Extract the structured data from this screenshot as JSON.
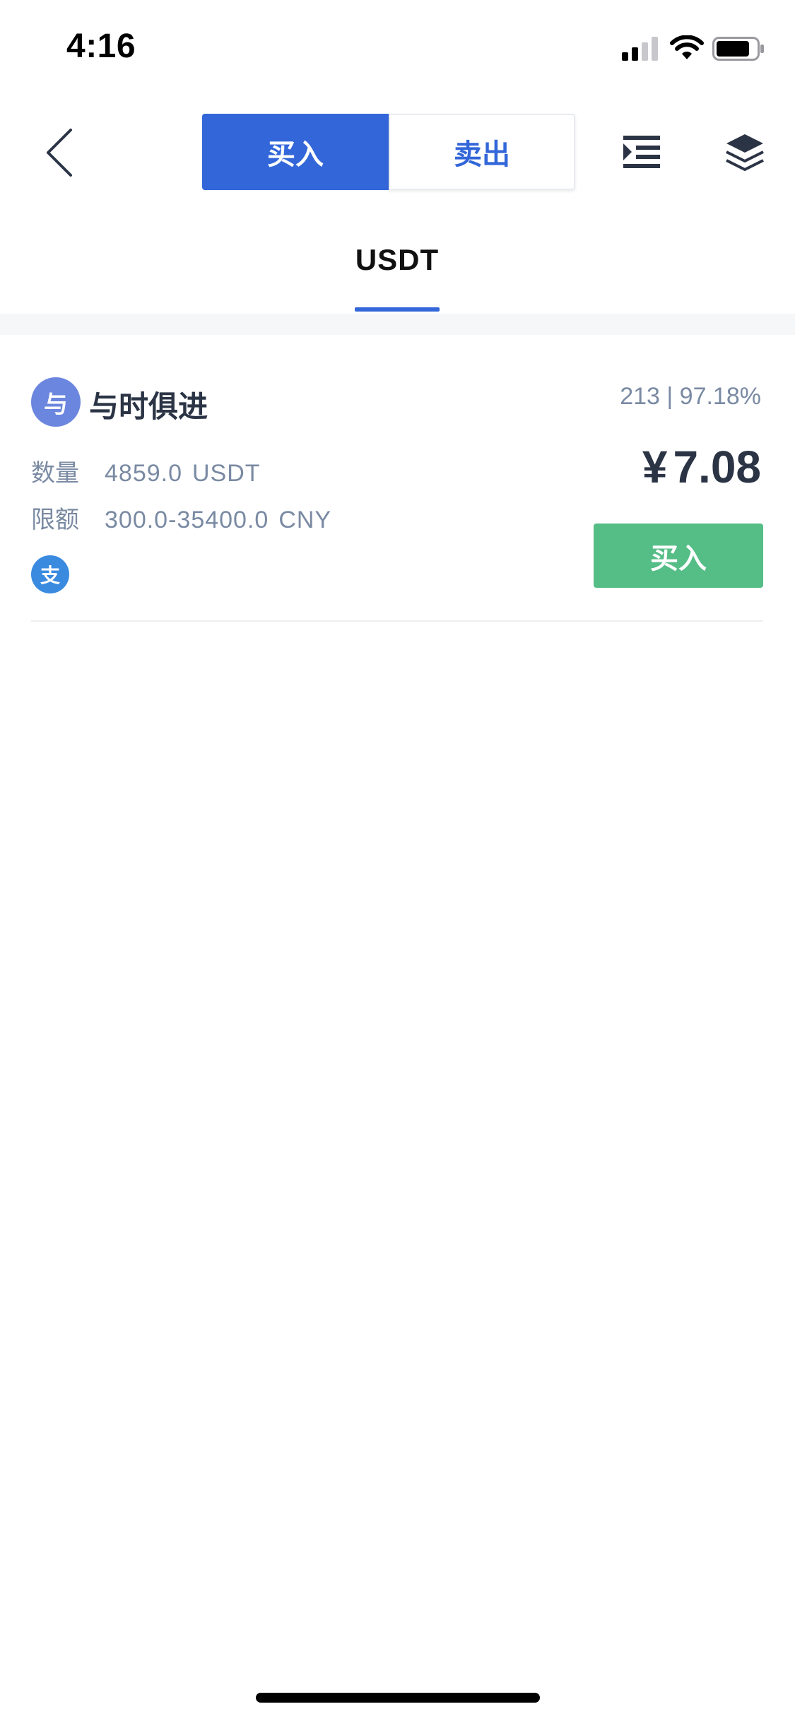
{
  "status_bar": {
    "time": "4:16"
  },
  "nav": {
    "segments": [
      {
        "label": "买入",
        "active": true
      },
      {
        "label": "卖出",
        "active": false
      }
    ],
    "icons": {
      "back": "chevron-left-icon",
      "filter": "indent-list-icon",
      "layers": "layers-icon"
    }
  },
  "coin_tabs": [
    {
      "label": "USDT",
      "active": true
    }
  ],
  "ads": [
    {
      "avatar_char": "与",
      "merchant": "与时俱进",
      "stats": "213 | 97.18%",
      "quantity_label": "数量",
      "quantity_value": "4859.0",
      "quantity_unit": "USDT",
      "limit_label": "限额",
      "limit_value": "300.0-35400.0",
      "limit_unit": "CNY",
      "price_symbol": "¥",
      "price": "7.08",
      "payment_char": "支",
      "button_label": "买入"
    }
  ],
  "colors": {
    "primary": "#3266d9",
    "buy_green": "#55bd86",
    "text_dark": "#2b3445",
    "text_muted": "#7a8aa3",
    "avatar": "#6b86de",
    "alipay": "#3a8be0"
  }
}
